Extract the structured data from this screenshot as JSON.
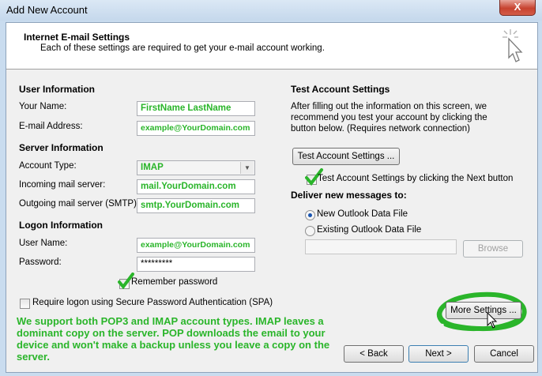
{
  "window": {
    "title": "Add New Account",
    "close_glyph": "X"
  },
  "header": {
    "title": "Internet E-mail Settings",
    "subtitle": "Each of these settings are required to get your e-mail account working."
  },
  "user_info": {
    "heading": "User Information",
    "name_label": "Your Name:",
    "name_value": "FirstName LastName",
    "email_label": "E-mail Address:",
    "email_value": "example@YourDomain.com"
  },
  "server_info": {
    "heading": "Server Information",
    "account_type_label": "Account Type:",
    "account_type_value": "IMAP",
    "incoming_label": "Incoming mail server:",
    "incoming_value": "mail.YourDomain.com",
    "outgoing_label": "Outgoing mail server (SMTP):",
    "outgoing_value": "smtp.YourDomain.com"
  },
  "logon_info": {
    "heading": "Logon Information",
    "username_label": "User Name:",
    "username_value": "example@YourDomain.com",
    "password_label": "Password:",
    "password_value": "*********",
    "remember_label": "Remember password",
    "spa_label": "Require logon using Secure Password Authentication (SPA)"
  },
  "test_settings": {
    "heading": "Test Account Settings",
    "description": "After filling out the information on this screen, we recommend you test your account by clicking the button below. (Requires network connection)",
    "test_button": "Test Account Settings ...",
    "test_next_label": "Test Account Settings by clicking the Next button",
    "deliver_heading": "Deliver new messages to:",
    "option_new": "New Outlook Data File",
    "option_existing": "Existing Outlook Data File",
    "browse_button": "Browse",
    "more_settings_button": "More Settings ..."
  },
  "annotation": "We support both POP3 and IMAP account types. IMAP leaves a dominant copy on the server. POP downloads the email to your device and won't make a backup unless you leave a copy on the server.",
  "footer": {
    "back_button": "< Back",
    "next_button": "Next >",
    "cancel_button": "Cancel"
  },
  "colors": {
    "annotation_green": "#2ab52a",
    "window_frame": "#c9dcef",
    "close_red": "#c7432f"
  }
}
